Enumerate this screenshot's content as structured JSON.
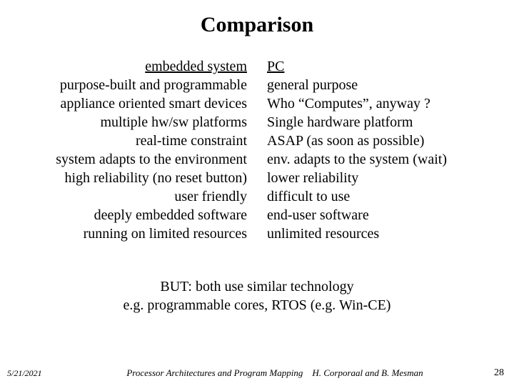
{
  "title": "Comparison",
  "left": {
    "heading": "embedded system",
    "items": [
      "purpose-built and programmable",
      "appliance oriented smart devices",
      "multiple hw/sw platforms",
      "real-time constraint",
      "system adapts to the environment",
      "high reliability (no reset button)",
      "user friendly",
      "deeply embedded software",
      "running on limited resources"
    ]
  },
  "right": {
    "heading": "PC",
    "items": [
      "general purpose",
      "Who “Computes”, anyway ?",
      "Single hardware platform",
      "ASAP (as soon as possible)",
      "env. adapts to the system (wait)",
      "lower reliability",
      "difficult to use",
      "end-user software",
      "unlimited resources"
    ]
  },
  "footer": {
    "line1": "BUT: both use similar technology",
    "line2": "e.g. programmable cores, RTOS (e.g. Win-CE)"
  },
  "meta": {
    "date": "5/21/2021",
    "course": "Processor Architectures and Program Mapping",
    "authors": "H. Corporaal and B. Mesman",
    "page": "28"
  }
}
